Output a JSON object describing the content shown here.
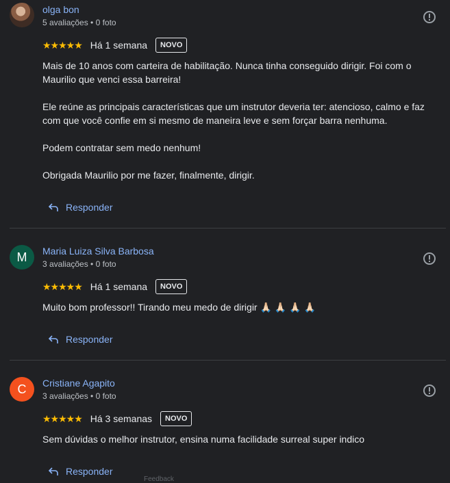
{
  "reviews": [
    {
      "name": "olga bon",
      "meta": "5 avaliações • 0 foto",
      "stars": "★★★★★",
      "time": "Há 1 semana",
      "badge": "NOVO",
      "paragraphs": [
        "Mais de 10 anos com carteira de habilitação. Nunca tinha conseguido dirigir. Foi com o Maurilio que venci essa barreira!",
        "Ele reúne as principais características que um instrutor deveria ter: atencioso, calmo e faz com que você confie em si mesmo de maneira leve e sem forçar barra nenhuma.",
        "Podem contratar sem medo nenhum!",
        "Obrigada Maurilio por me fazer, finalmente, dirigir."
      ],
      "reply_label": "Responder"
    },
    {
      "name": "Maria Luiza Silva Barbosa",
      "initial": "M",
      "avatar_color": "#0b5a45",
      "meta": "3 avaliações • 0 foto",
      "stars": "★★★★★",
      "time": "Há 1 semana",
      "badge": "NOVO",
      "paragraphs": [
        "Muito bom professor!! Tirando meu medo de dirigir 🙏🏻 🙏🏻 🙏🏻 🙏🏻"
      ],
      "reply_label": "Responder"
    },
    {
      "name": "Cristiane Agapito",
      "initial": "C",
      "avatar_color": "#f4511e",
      "meta": "3 avaliações • 0 foto",
      "stars": "★★★★★",
      "time": "Há 3 semanas",
      "badge": "NOVO",
      "paragraphs": [
        "Sem dúvidas o melhor instrutor, ensina numa facilidade surreal super indico"
      ],
      "reply_label": "Responder"
    }
  ],
  "footer": {
    "feedback": "Feedback"
  },
  "colors": {
    "background": "#202124",
    "link": "#8ab4f8",
    "star": "#fbbc04"
  }
}
